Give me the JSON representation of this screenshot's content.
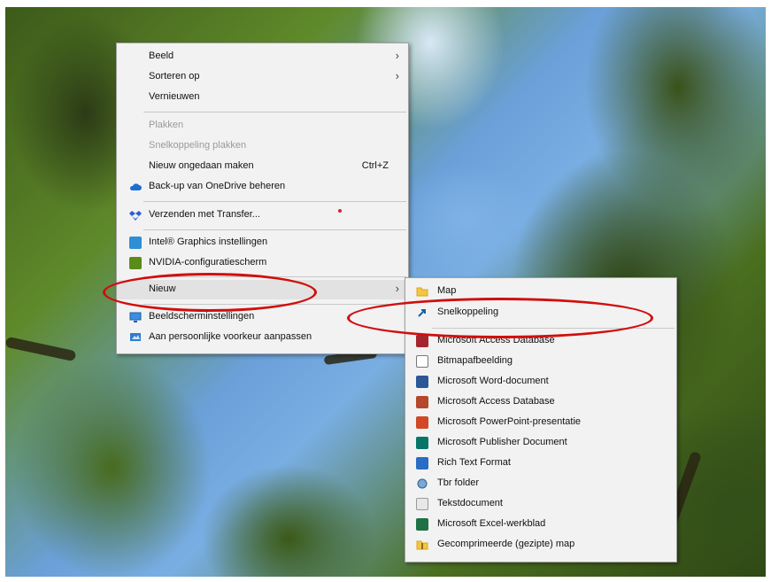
{
  "context_menu": {
    "items": [
      {
        "label": "Beeld",
        "has_submenu": true
      },
      {
        "label": "Sorteren op",
        "has_submenu": true
      },
      {
        "label": "Vernieuwen"
      },
      {
        "label": "Plakken",
        "disabled": true
      },
      {
        "label": "Snelkoppeling plakken",
        "disabled": true
      },
      {
        "label": "Nieuw ongedaan maken",
        "shortcut": "Ctrl+Z"
      },
      {
        "label": "Back-up van OneDrive beheren",
        "icon": "onedrive-cloud-icon"
      },
      {
        "label": "Verzenden met Transfer...",
        "icon": "dropbox-transfer-icon"
      },
      {
        "label": "Intel® Graphics instellingen",
        "icon": "intel-graphics-icon"
      },
      {
        "label": "NVIDIA-configuratiescherm",
        "icon": "nvidia-icon"
      },
      {
        "label": "Nieuw",
        "has_submenu": true,
        "highlighted": true
      },
      {
        "label": "Beeldscherminstellingen",
        "icon": "display-settings-icon"
      },
      {
        "label": "Aan persoonlijke voorkeur aanpassen",
        "icon": "personalize-icon"
      }
    ]
  },
  "submenu_new": {
    "items": [
      {
        "label": "Map",
        "icon": "folder-icon"
      },
      {
        "label": "Snelkoppeling",
        "icon": "shortcut-icon"
      },
      {
        "label": "Microsoft Access Database",
        "icon": "access-icon"
      },
      {
        "label": "Bitmapafbeelding",
        "icon": "bitmap-icon"
      },
      {
        "label": "Microsoft Word-document",
        "icon": "word-icon"
      },
      {
        "label": "Microsoft Access Database",
        "icon": "access-icon"
      },
      {
        "label": "Microsoft PowerPoint-presentatie",
        "icon": "powerpoint-icon"
      },
      {
        "label": "Microsoft Publisher Document",
        "icon": "publisher-icon"
      },
      {
        "label": "Rich Text Format",
        "icon": "rtf-icon"
      },
      {
        "label": "Tbr folder",
        "icon": "tbr-folder-icon"
      },
      {
        "label": "Tekstdocument",
        "icon": "text-document-icon"
      },
      {
        "label": "Microsoft Excel-werkblad",
        "icon": "excel-icon"
      },
      {
        "label": "Gecomprimeerde (gezipte) map",
        "icon": "zip-folder-icon"
      }
    ]
  },
  "colors": {
    "annotation_red": "#d10e0e",
    "menu_background": "#f2f2f2"
  }
}
